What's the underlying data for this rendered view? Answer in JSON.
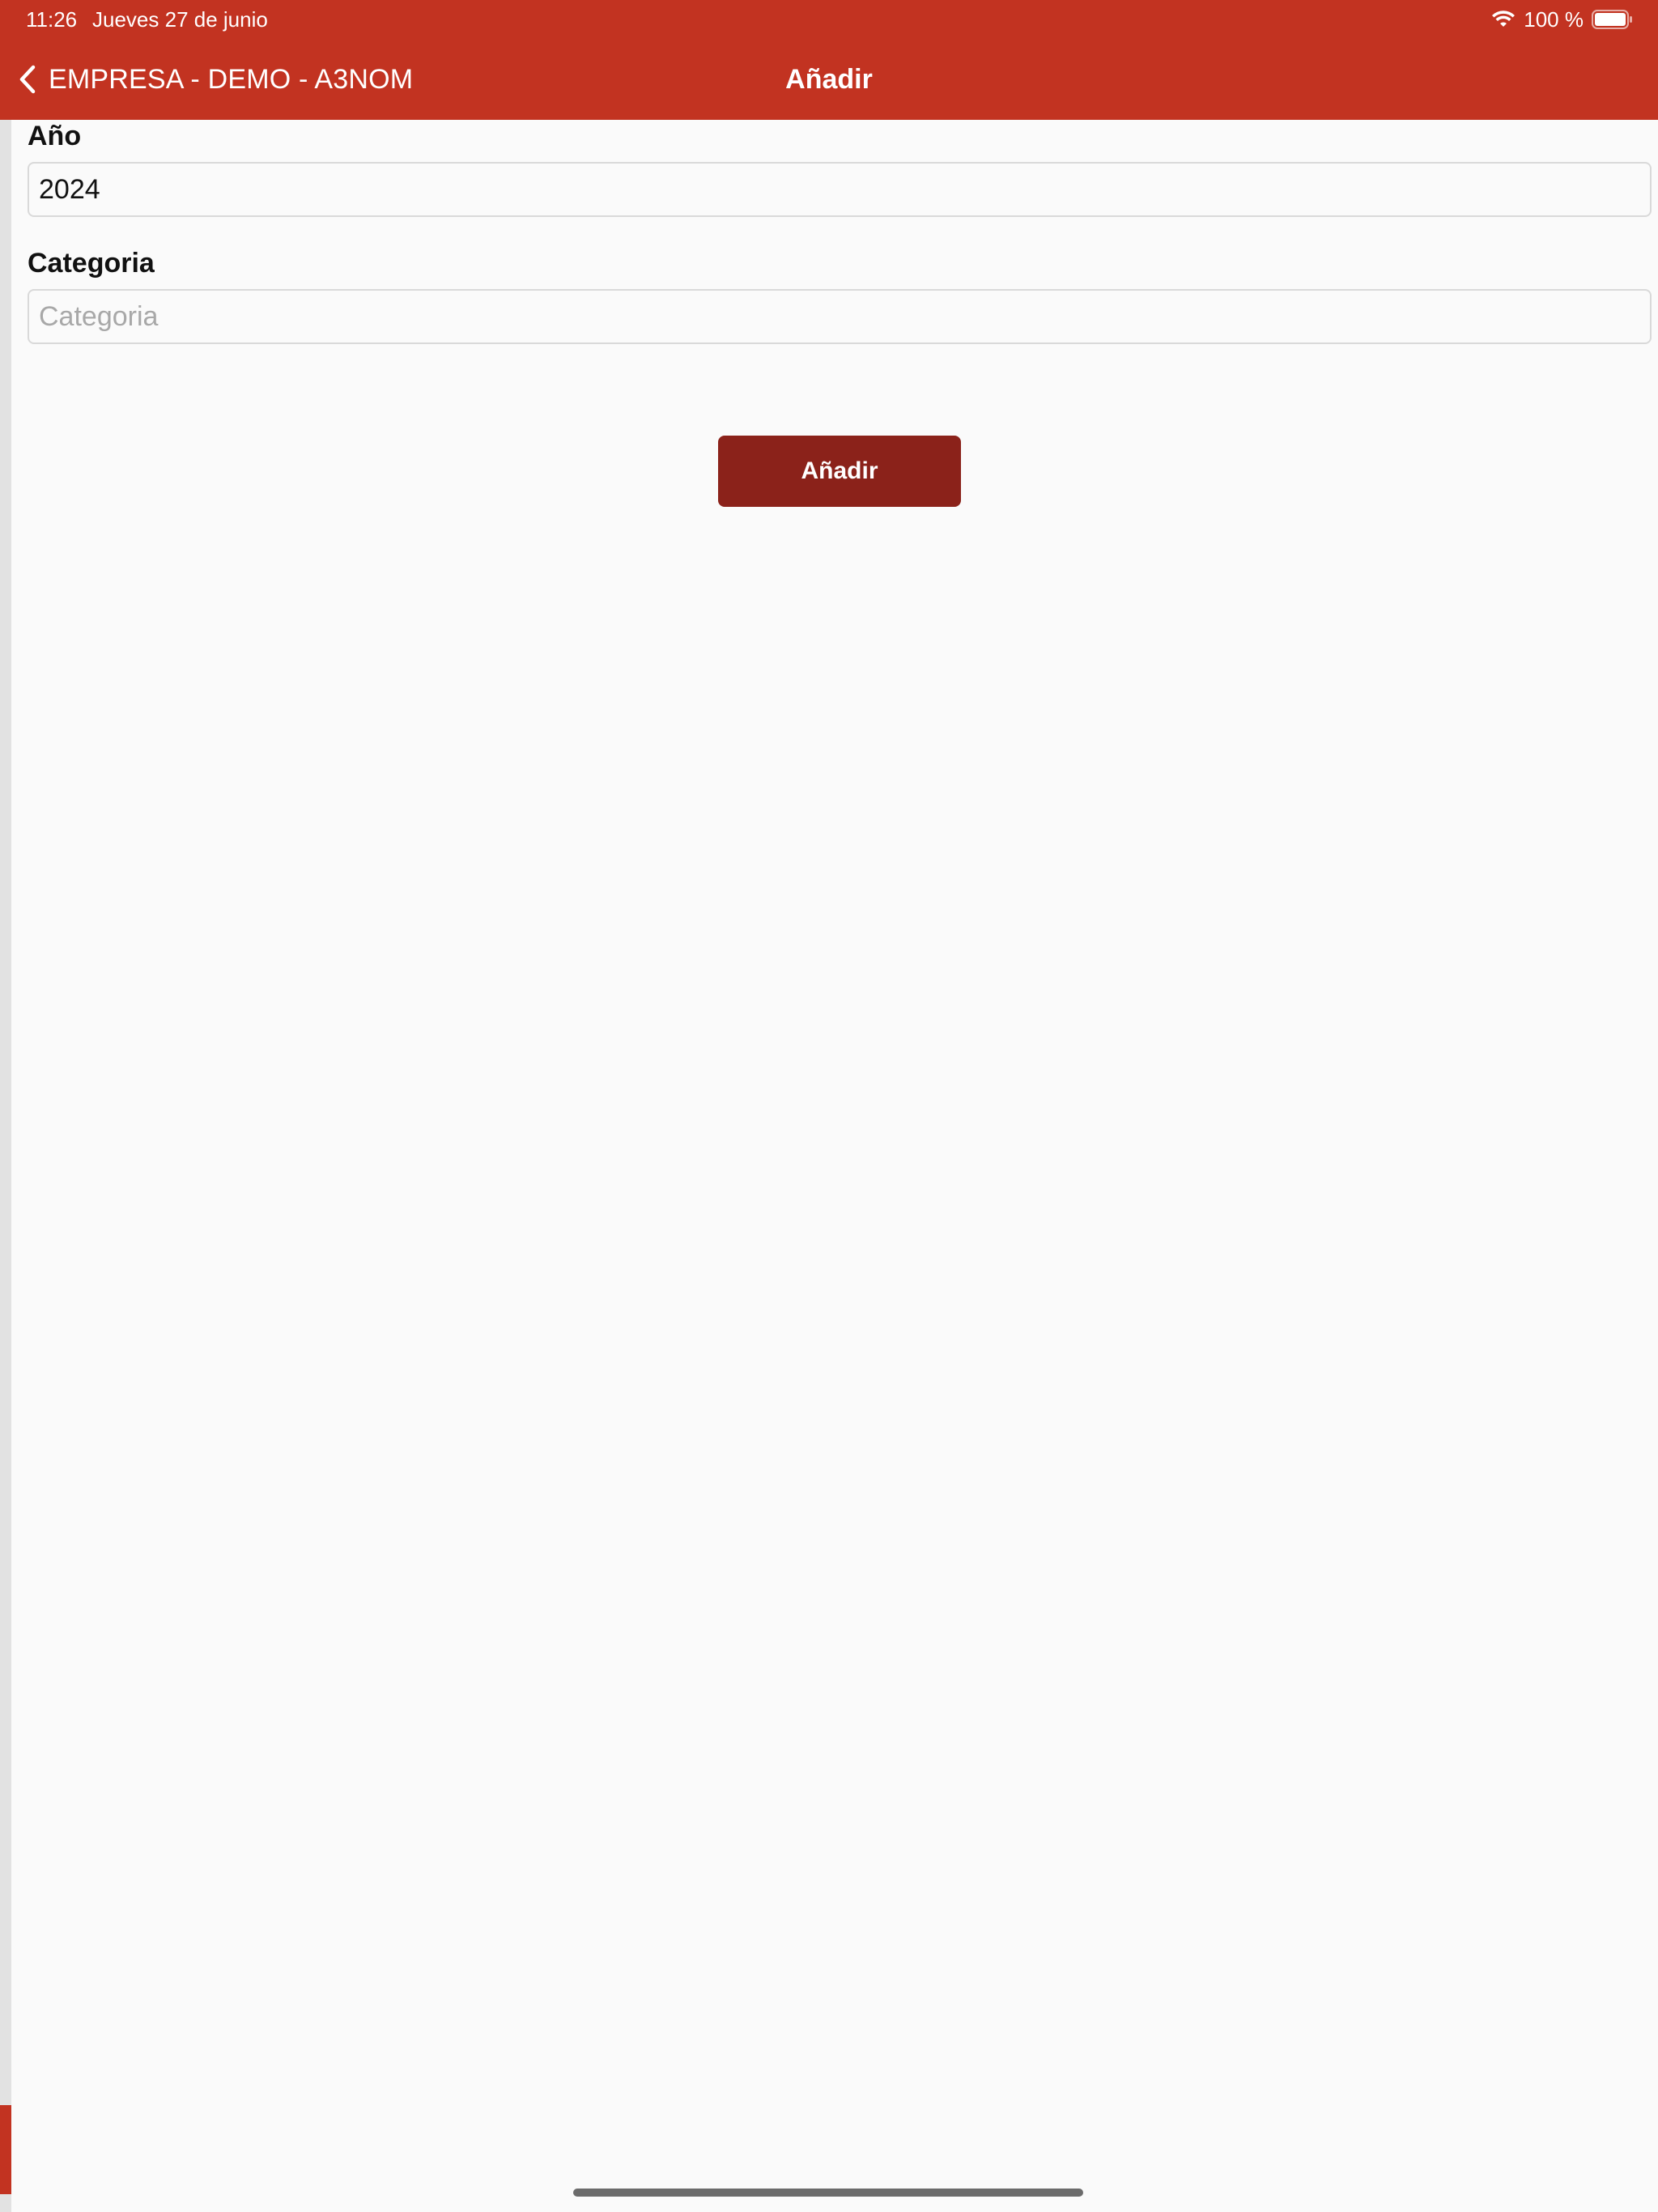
{
  "status_bar": {
    "time": "11:26",
    "date": "Jueves 27 de junio",
    "battery_text": "100 %"
  },
  "nav_bar": {
    "back_label": "EMPRESA - DEMO - A3NOM",
    "title": "Añadir"
  },
  "form": {
    "year": {
      "label": "Año",
      "value": "2024"
    },
    "category": {
      "label": "Categoria",
      "value": "",
      "placeholder": "Categoria"
    },
    "submit_label": "Añadir"
  },
  "colors": {
    "header_background": "#c23321",
    "button_background": "#8b221a",
    "page_background": "#fafafa"
  },
  "icons": [
    "wifi-icon",
    "battery-icon",
    "chevron-left-icon"
  ]
}
